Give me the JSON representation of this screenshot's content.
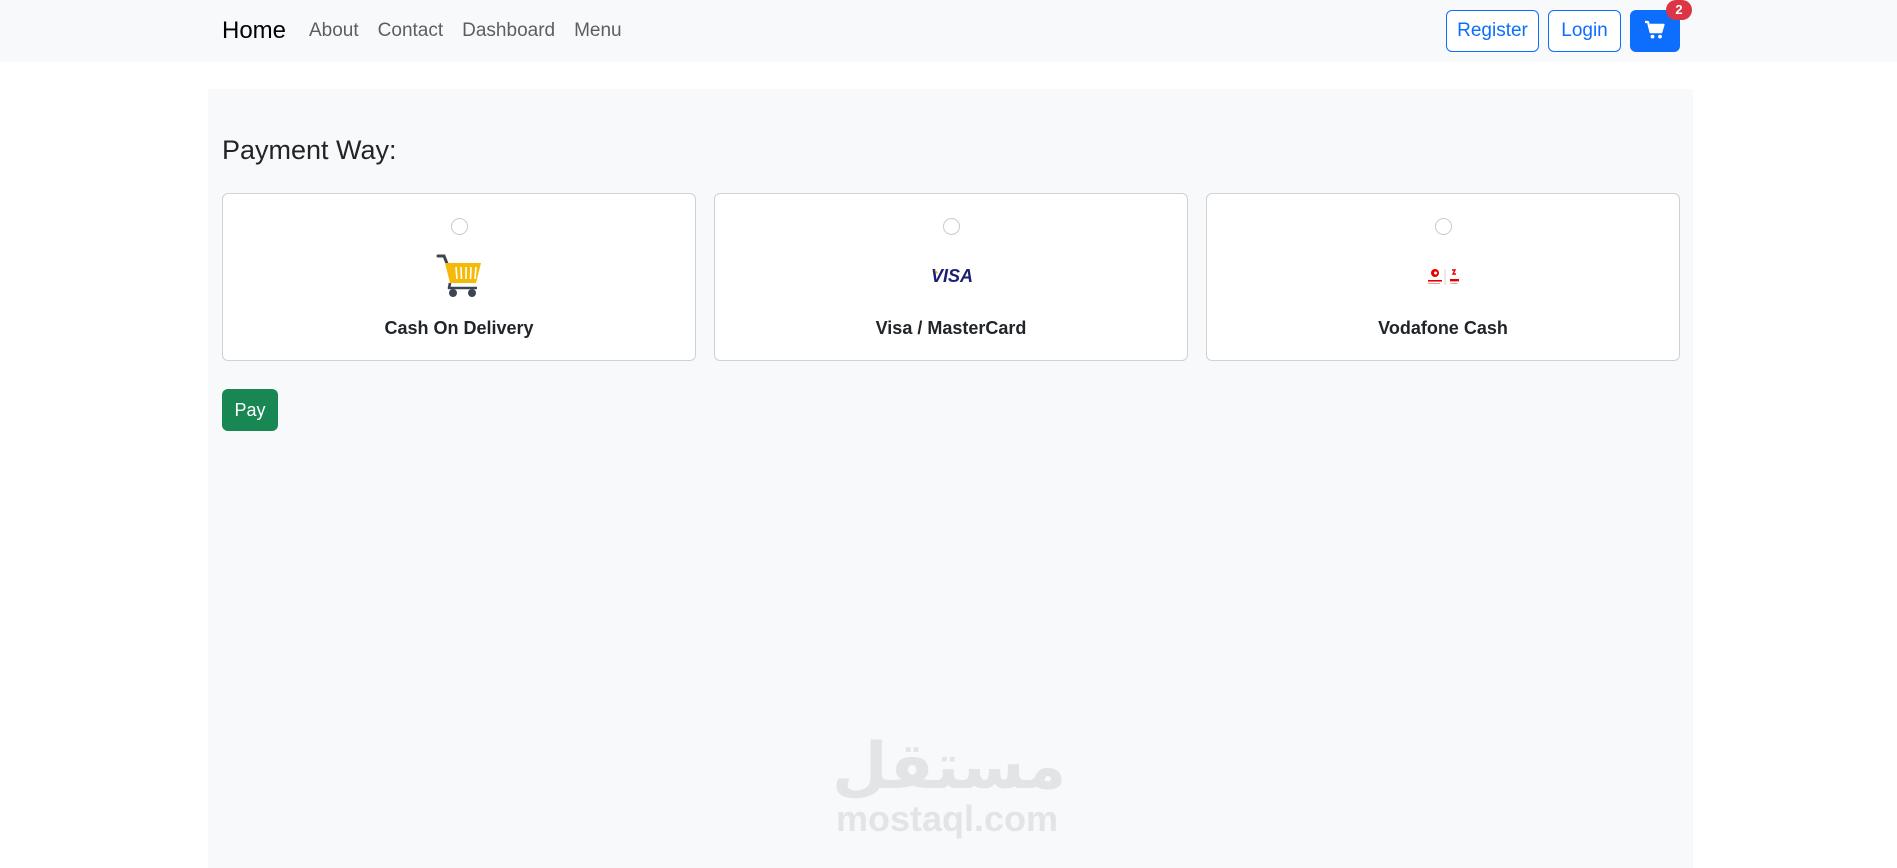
{
  "navbar": {
    "brand": "Home",
    "links": [
      "About",
      "Contact",
      "Dashboard",
      "Menu"
    ],
    "register_label": "Register",
    "login_label": "Login",
    "cart_icon": "cart-icon",
    "cart_count": "2"
  },
  "main": {
    "title": "Payment Way:",
    "options": [
      {
        "label": "Cash On Delivery",
        "icon": "shopping-cart-icon",
        "selected": false
      },
      {
        "label": "Visa / MasterCard",
        "icon": "visa-logo",
        "selected": false,
        "logo_text": "VISA"
      },
      {
        "label": "Vodafone Cash",
        "icon": "vodafone-cash-logo",
        "selected": false
      }
    ],
    "pay_label": "Pay"
  },
  "watermark": {
    "arabic": "مستقل",
    "latin": "mostaql.com"
  },
  "colors": {
    "primary": "#0d6efd",
    "success": "#198754",
    "danger": "#dc3545",
    "navbar_bg": "#f8f9fa",
    "container_bg": "#f8f9fa"
  }
}
